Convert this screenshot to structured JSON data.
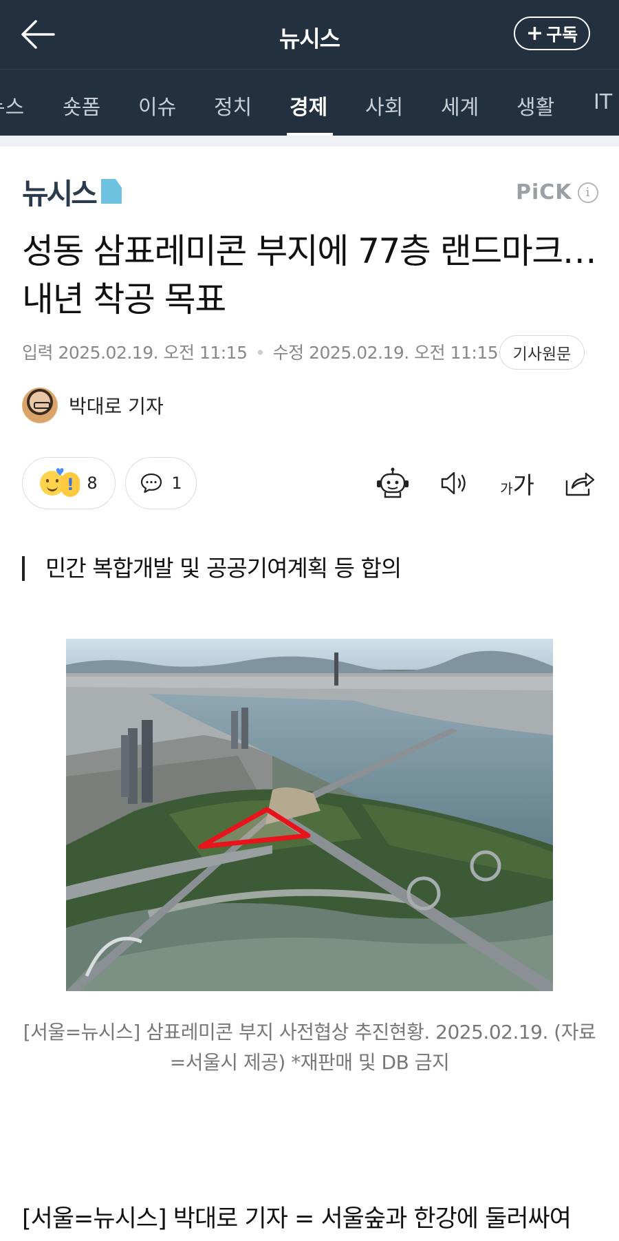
{
  "topbar": {
    "brand": "뉴시스",
    "back_icon": "arrow-left-icon",
    "subscribe_label": "구독",
    "subscribe_icon": "plus-icon"
  },
  "tabs": [
    {
      "label": "뉴스"
    },
    {
      "label": "숏폼"
    },
    {
      "label": "이슈"
    },
    {
      "label": "정치"
    },
    {
      "label": "경제",
      "active": true
    },
    {
      "label": "사회"
    },
    {
      "label": "세계"
    },
    {
      "label": "생활"
    },
    {
      "label": "IT"
    }
  ],
  "article": {
    "press_logo": "뉴시스",
    "pick_label": "PiCK",
    "info_icon": "info-icon",
    "headline": "성동 삼표레미콘 부지에 77층 랜드마크…내년 착공 목표",
    "input_label": "입력",
    "input_date": "2025.02.19. 오전 11:15",
    "modified_label": "수정",
    "modified_date": "2025.02.19. 오전 11:15",
    "original_button": "기사원문",
    "reporter": "박대로 기자",
    "reaction_count": "8",
    "comment_count": "1",
    "tools": [
      "robot-summary-icon",
      "speaker-icon",
      "font-size-icon",
      "share-icon"
    ],
    "font_size_small": "가",
    "font_size_large": "가",
    "subheadline": "민간 복합개발 및 공공기여계획 등 합의",
    "photo_caption": "[서울=뉴시스] 삼표레미콘 부지 사전협상 추진현황. 2025.02.19. (자료=서울시 제공) *재판매 및 DB 금지",
    "body_first_line": "[서울=뉴시스] 박대로 기자 = 서울숲과 한강에 둘러싸여"
  },
  "colors": {
    "header_bg": "#23303f",
    "highlight_outline": "#e8141c",
    "logo_accent": "#6cc2df"
  }
}
